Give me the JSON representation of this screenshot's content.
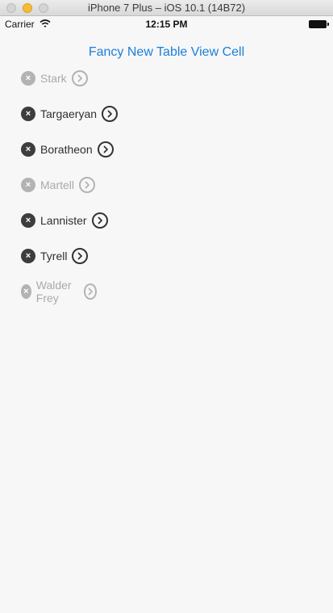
{
  "window": {
    "title": "iPhone 7 Plus – iOS 10.1 (14B72)"
  },
  "status_bar": {
    "carrier": "Carrier",
    "time": "12:15 PM"
  },
  "nav": {
    "title": "Fancy New Table View Cell"
  },
  "rows": [
    {
      "name": "Stark",
      "enabled": false
    },
    {
      "name": "Targaeryan",
      "enabled": true
    },
    {
      "name": "Boratheon",
      "enabled": true
    },
    {
      "name": "Martell",
      "enabled": false
    },
    {
      "name": "Lannister",
      "enabled": true
    },
    {
      "name": "Tyrell",
      "enabled": true
    },
    {
      "name": "Walder Frey",
      "enabled": false
    }
  ],
  "icons": {
    "delete": "x-circle-icon",
    "disclosure": "chevron-right-circle-icon"
  },
  "colors": {
    "accent": "#1a7fd9",
    "enabled_icon": "#3d3d3d",
    "disabled_icon": "#b3b3b3"
  }
}
